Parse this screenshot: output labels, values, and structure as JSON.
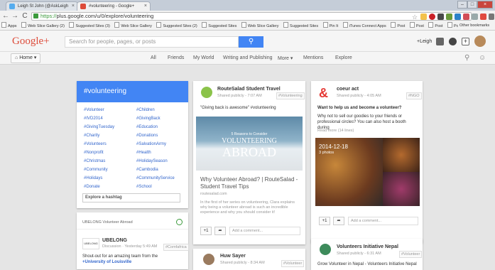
{
  "browser": {
    "tabs": [
      {
        "label": "Leigh St John (@AskLeigh",
        "active": false
      },
      {
        "label": "#volunteering - Google+",
        "active": true
      }
    ],
    "url_prefix": "https://",
    "url": "plus.google.com/u/0/explore/volunteering",
    "bookmarks": [
      "Apps",
      "Web Slice Gallery (2)",
      "Suggested Sites (3)",
      "Web Slice Gallery",
      "Suggested Sites (2)",
      "Suggested Sites",
      "Web Slice Gallery",
      "Suggested Sites",
      "Pin It",
      "iTunes Connect Apps",
      "Post",
      "Post",
      "Post",
      "Post"
    ],
    "other_bookmarks": "Other bookmarks"
  },
  "gplus": {
    "logo": "Google+",
    "search_placeholder": "Search for people, pages, or posts",
    "user": "+Leigh",
    "home": "Home",
    "nav": [
      "All",
      "Friends",
      "My World",
      "Writing and Publishing",
      "More",
      "Mentions",
      "Explore"
    ]
  },
  "hashtags": {
    "title": "#volunteering",
    "left": [
      "#Volunteer",
      "#IVD2014",
      "#GivingTuesday",
      "#Charity",
      "#Volunteers",
      "#Nonprofit",
      "#Christmas",
      "#Community",
      "#Holidays",
      "#Donate"
    ],
    "right": [
      "#Children",
      "#GivingBack",
      "#Education",
      "#Donations",
      "#SalvationArmy",
      "#Health",
      "#HolidaySeason",
      "#Cambodia",
      "#CommunityService",
      "#School"
    ],
    "explore_placeholder": "Explore a hashtag"
  },
  "ubelong": {
    "header": "UBELONG Volunteer Abroad",
    "logo_text": "UBELONG",
    "name": "UBELONG",
    "meta": "Discussion · Yesterday 5:49 AM",
    "badge": "#Comfafrica",
    "text": "Shout-out for an amazing team from the ",
    "text_bold": "+University of Louisville"
  },
  "routesalad": {
    "name": "RouteSalad Student Travel",
    "meta": "Shared publicly - 7:07 AM",
    "badge": "#Volunteering",
    "quote": "\"Giving back is awesome\" #volunteering",
    "img_line1": "5 Reasons to Consider",
    "img_line2": "VOLUNTEERING",
    "img_line3": "ABROAD",
    "link_title": "Why Volunteer Abroad? | RouteSalad - Student Travel Tips",
    "link_domain": "routesalad.com",
    "link_desc": "In the first of her series on volunteering, Clara explains why being a volunteer abroad is such an incredible experience and why you should consider it!",
    "plus": "+1",
    "comment": "Add a comment..."
  },
  "coeur": {
    "name": "coeur act",
    "meta": "Shared publicly - 4:05 AM",
    "badge": "#NGO",
    "headline": "Want to help us and become a volunteer?",
    "text": "Why not to sell our goodies to your friends or professional circles? You can also host a booth during",
    "more": "Read more (14 lines)",
    "date": "2014-12-18",
    "photos": "3 photos",
    "plus": "+1",
    "comment": "Add a comment..."
  },
  "hugh": {
    "name": "Huw Sayer",
    "meta": "Shared publicly - 8:34 AM",
    "badge": "#Volunteer"
  },
  "vin": {
    "name": "Volunteers Initiative Nepal",
    "meta": "Shared publicly - 6:31 AM",
    "badge": "#Volunteer",
    "text": "Grow Volunteer in Nepal - Volunteers Initiative Nepal"
  },
  "colors": {
    "accent": "#4285f4",
    "brand": "#dd4b39"
  }
}
